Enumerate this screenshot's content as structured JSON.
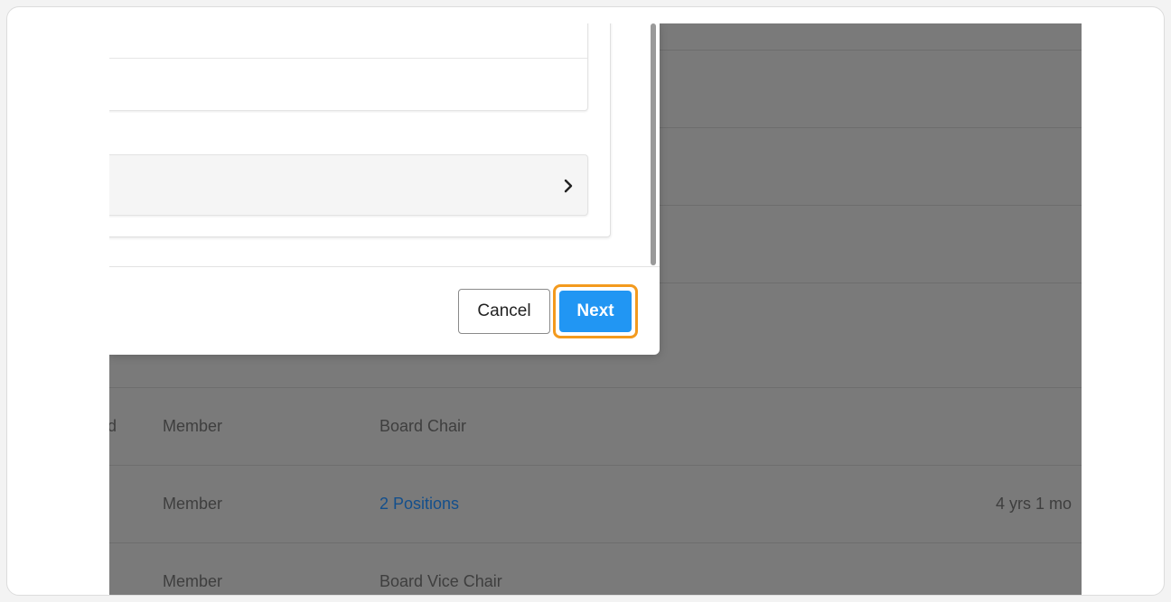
{
  "modal": {
    "buttons": {
      "cancel_label": "Cancel",
      "next_label": "Next"
    },
    "expander_icon": "chevron-right-icon"
  },
  "table": {
    "rows": [
      {
        "status": "ed",
        "role": "Member",
        "position": "Board Chair",
        "tenure": ""
      },
      {
        "status": "",
        "role": "Member",
        "position": "2 Positions",
        "tenure": "4 yrs 1 mo"
      },
      {
        "status": "",
        "role": "Member",
        "position": "Board Vice Chair",
        "tenure": ""
      }
    ]
  },
  "colors": {
    "overlay_background": "#7a7a7a",
    "primary_button": "#2196f3",
    "highlight_border": "#f39a1e",
    "link": "#134f8c"
  }
}
